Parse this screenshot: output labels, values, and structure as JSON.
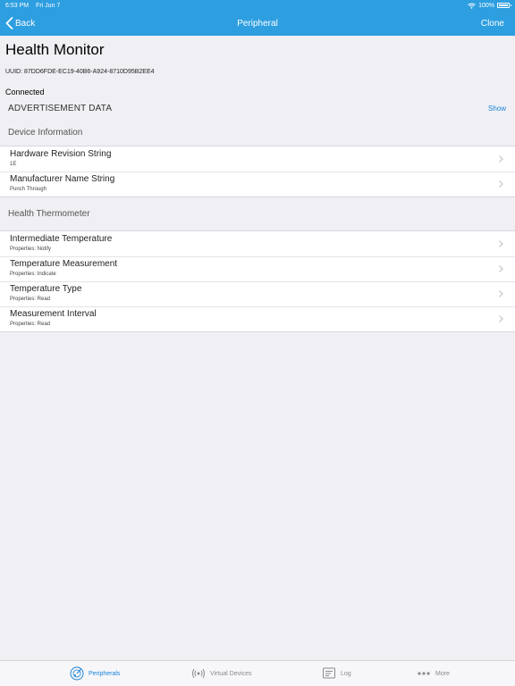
{
  "status_bar": {
    "time": "6:53 PM",
    "date": "Fri Jun 7",
    "battery": "100%"
  },
  "nav": {
    "back_label": "Back",
    "title": "Peripheral",
    "clone_label": "Clone"
  },
  "device": {
    "name": "Health Monitor",
    "uuid": "UUID: 87DD6FDE-EC19-40B6-A924-8710D95B2EE4",
    "status": "Connected"
  },
  "advertisement": {
    "label": "ADVERTISEMENT DATA",
    "action": "Show"
  },
  "sections": [
    {
      "header": "Device Information",
      "rows": [
        {
          "title": "Hardware Revision String",
          "subtitle": "1E"
        },
        {
          "title": "Manufacturer Name String",
          "subtitle": "Punch Through"
        }
      ]
    },
    {
      "header": "Health Thermometer",
      "rows": [
        {
          "title": "Intermediate Temperature",
          "subtitle": "Properties: Notify"
        },
        {
          "title": "Temperature Measurement",
          "subtitle": "Properties: Indicate"
        },
        {
          "title": "Temperature Type",
          "subtitle": "Properties: Read"
        },
        {
          "title": "Measurement Interval",
          "subtitle": "Properties: Read"
        }
      ]
    }
  ],
  "tabs": [
    {
      "label": "Peripherals",
      "icon": "radar-icon",
      "active": true
    },
    {
      "label": "Virtual Devices",
      "icon": "broadcast-icon",
      "active": false
    },
    {
      "label": "Log",
      "icon": "log-icon",
      "active": false
    },
    {
      "label": "More",
      "icon": "more-icon",
      "active": false
    }
  ],
  "colors": {
    "accent": "#2d9ee0",
    "link": "#1a84d6",
    "background": "#efeff4"
  }
}
